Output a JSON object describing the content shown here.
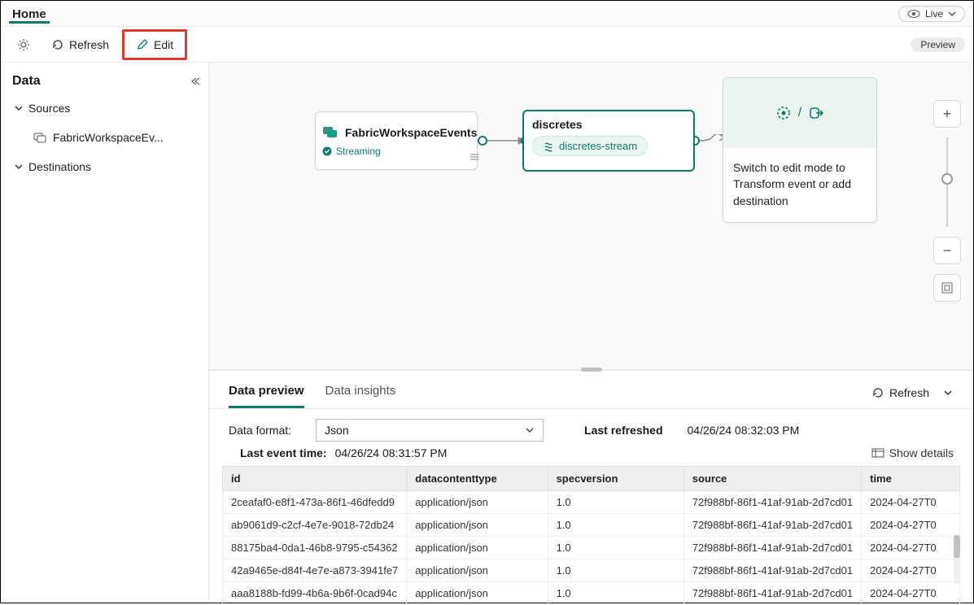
{
  "header": {
    "tab": "Home",
    "live_label": "Live"
  },
  "toolbar": {
    "refresh": "Refresh",
    "edit": "Edit",
    "preview": "Preview"
  },
  "sidebar": {
    "title": "Data",
    "sections": [
      {
        "label": "Sources",
        "items": [
          {
            "label": "FabricWorkspaceEv..."
          }
        ]
      },
      {
        "label": "Destinations",
        "items": []
      }
    ]
  },
  "canvas": {
    "source_node": {
      "title": "FabricWorkspaceEvents",
      "status": "Streaming"
    },
    "stream_node": {
      "title": "discretes",
      "pill": "discretes-stream"
    },
    "dest_node": {
      "message": "Switch to edit mode to Transform event or add destination"
    }
  },
  "panel": {
    "tabs": {
      "preview": "Data preview",
      "insights": "Data insights"
    },
    "active_tab": "preview",
    "refresh_label": "Refresh",
    "format_label": "Data format:",
    "format_value": "Json",
    "last_refreshed_label": "Last refreshed",
    "last_refreshed_value": "04/26/24 08:32:03 PM",
    "last_event_label": "Last event time:",
    "last_event_value": "04/26/24 08:31:57 PM",
    "show_details": "Show details",
    "columns": [
      "id",
      "datacontenttype",
      "specversion",
      "source",
      "time"
    ],
    "rows": [
      {
        "id": "2ceafaf0-e8f1-473a-86f1-46dfedd9",
        "datacontenttype": "application/json",
        "specversion": "1.0",
        "source": "72f988bf-86f1-41af-91ab-2d7cd01",
        "time": "2024-04-27T0"
      },
      {
        "id": "ab9061d9-c2cf-4e7e-9018-72db24",
        "datacontenttype": "application/json",
        "specversion": "1.0",
        "source": "72f988bf-86f1-41af-91ab-2d7cd01",
        "time": "2024-04-27T0"
      },
      {
        "id": "88175ba4-0da1-46b8-9795-c54362",
        "datacontenttype": "application/json",
        "specversion": "1.0",
        "source": "72f988bf-86f1-41af-91ab-2d7cd01",
        "time": "2024-04-27T0"
      },
      {
        "id": "42a9465e-d84f-4e7e-a873-3941fe7",
        "datacontenttype": "application/json",
        "specversion": "1.0",
        "source": "72f988bf-86f1-41af-91ab-2d7cd01",
        "time": "2024-04-27T0"
      },
      {
        "id": "aaa8188b-fd99-4b6a-9b6f-0cad94c",
        "datacontenttype": "application/json",
        "specversion": "1.0",
        "source": "72f988bf-86f1-41af-91ab-2d7cd01",
        "time": "2024-04-27T0"
      }
    ]
  }
}
